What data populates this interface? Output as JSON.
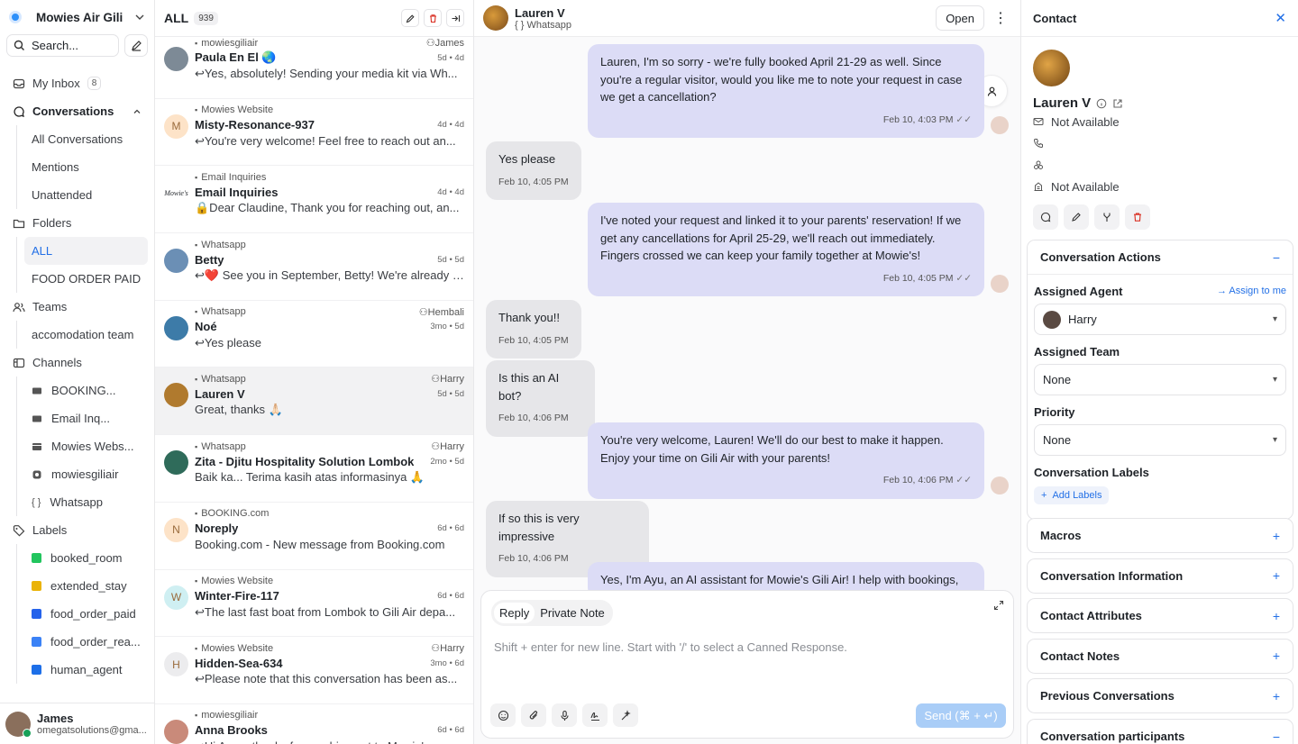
{
  "sidebar": {
    "account_name": "Mowies Air Gili",
    "search_label": "Search...",
    "my_inbox": {
      "label": "My Inbox",
      "count": "8"
    },
    "conversations_label": "Conversations",
    "conversation_items": [
      "All Conversations",
      "Mentions",
      "Unattended"
    ],
    "folders_label": "Folders",
    "folder_items": [
      "ALL",
      "FOOD ORDER PAID"
    ],
    "teams_label": "Teams",
    "team_items": [
      "accomodation team"
    ],
    "channels_label": "Channels",
    "channel_items": [
      "BOOKING...",
      "Email Inq...",
      "Mowies Webs...",
      "mowiesgiliair",
      "Whatsapp"
    ],
    "labels_label": "Labels",
    "label_items": [
      {
        "name": "booked_room",
        "color": "#22c55e"
      },
      {
        "name": "extended_stay",
        "color": "#eab308"
      },
      {
        "name": "food_order_paid",
        "color": "#2563eb"
      },
      {
        "name": "food_order_rea...",
        "color": "#3b82f6"
      },
      {
        "name": "human_agent",
        "color": "#1d6fe8"
      }
    ],
    "user": {
      "name": "James",
      "email": "omegatsolutions@gma..."
    }
  },
  "list": {
    "title": "ALL",
    "count": "939",
    "items": [
      {
        "source": "mowiesgiliair",
        "agent": "James",
        "name": "Paula En El 🌏",
        "time": "5d • 4d",
        "preview": "↩Yes, absolutely! Sending your media kit via Wh...",
        "avatar_color": "#7d8a96",
        "avatar_text": ""
      },
      {
        "source": "Mowies Website",
        "agent": "",
        "name": "Misty-Resonance-937",
        "time": "4d • 4d",
        "preview": "↩You're very welcome! Feel free to reach out an...",
        "avatar_color": "#fde3c8",
        "avatar_text": "M"
      },
      {
        "source": "Email Inquiries",
        "agent": "",
        "name": "Email Inquiries",
        "time": "4d • 4d",
        "preview": "🔒Dear Claudine, Thank you for reaching out, an...",
        "avatar_color": "#ffffff",
        "avatar_text": "Mowie's"
      },
      {
        "source": "Whatsapp",
        "agent": "",
        "name": "Betty",
        "time": "5d • 5d",
        "preview": "↩❤️ See you in September, Betty! We're already l...",
        "avatar_color": "#6b8fb5",
        "avatar_text": ""
      },
      {
        "source": "Whatsapp",
        "agent": "Hembali",
        "name": "Noé",
        "time": "3mo • 5d",
        "preview": "↩Yes please",
        "avatar_color": "#3d7ba8",
        "avatar_text": ""
      },
      {
        "source": "Whatsapp",
        "agent": "Harry",
        "name": "Lauren V",
        "time": "5d • 5d",
        "preview": "Great, thanks 🙏🏻",
        "avatar_color": "#b07a2e",
        "avatar_text": ""
      },
      {
        "source": "Whatsapp",
        "agent": "Harry",
        "name": "Zita - Djitu Hospitality Solution Lombok",
        "time": "2mo • 5d",
        "preview": "Baik ka... Terima kasih atas informasinya 🙏",
        "avatar_color": "#2f6b5a",
        "avatar_text": ""
      },
      {
        "source": "BOOKING.com",
        "agent": "",
        "name": "Noreply",
        "time": "6d • 6d",
        "preview": "Booking.com - New message from Booking.com",
        "avatar_color": "#fde3c8",
        "avatar_text": "N"
      },
      {
        "source": "Mowies Website",
        "agent": "",
        "name": "Winter-Fire-117",
        "time": "6d • 6d",
        "preview": "↩The last fast boat from Lombok to Gili Air depa...",
        "avatar_color": "#cfeff2",
        "avatar_text": "W"
      },
      {
        "source": "Mowies Website",
        "agent": "Harry",
        "name": "Hidden-Sea-634",
        "time": "3mo • 6d",
        "preview": "↩Please note that this conversation has been as...",
        "avatar_color": "#ececee",
        "avatar_text": "H"
      },
      {
        "source": "mowiesgiliair",
        "agent": "",
        "name": "Anna Brooks",
        "time": "6d • 6d",
        "preview": "↩Hi Anna, thanks for reaching out to Mowie's...",
        "avatar_color": "#c98a7a",
        "avatar_text": ""
      }
    ]
  },
  "chat": {
    "contact_name": "Lauren V",
    "channel": "Whatsapp",
    "status_button": "Open",
    "messages": [
      {
        "dir": "out",
        "text": "Lauren, I'm so sorry - we're fully booked April 21-29 as well. Since you're a regular visitor, would you like me to note your request in case we get a cancellation?",
        "time": "Feb 10, 4:03 PM"
      },
      {
        "dir": "in",
        "text": "Yes please",
        "time": "Feb 10, 4:05 PM"
      },
      {
        "dir": "out",
        "text": "I've noted your request and linked it to your parents' reservation! If we get any cancellations for April 25-29, we'll reach out immediately. Fingers crossed we can keep your family together at Mowie's!",
        "time": "Feb 10, 4:05 PM"
      },
      {
        "dir": "in",
        "text": "Thank you!!",
        "time": "Feb 10, 4:05 PM"
      },
      {
        "dir": "in",
        "text": "Is this an AI bot?",
        "time": "Feb 10, 4:06 PM"
      },
      {
        "dir": "out",
        "text": "You're very welcome, Lauren! We'll do our best to make it happen. Enjoy your time on Gili Air with your parents!",
        "time": "Feb 10, 4:06 PM"
      },
      {
        "dir": "in",
        "text": "If so this is very impressive",
        "time": "Feb 10, 4:06 PM"
      },
      {
        "dir": "out",
        "text": "Yes, I'm Ayu, an AI assistant for Mowie's Gili Air! I help with bookings,",
        "time": ""
      }
    ],
    "composer": {
      "tab_reply": "Reply",
      "tab_note": "Private Note",
      "placeholder": "Shift + enter for new line. Start with '/' to select a Canned Response.",
      "send_label": "Send (⌘ + ↵)"
    }
  },
  "contact": {
    "title": "Contact",
    "name": "Lauren V",
    "email": "Not Available",
    "company": "Not Available",
    "actions_title": "Conversation Actions",
    "assigned_agent_label": "Assigned Agent",
    "assign_to_me": "Assign to me",
    "assigned_agent": "Harry",
    "assigned_team_label": "Assigned Team",
    "assigned_team": "None",
    "priority_label": "Priority",
    "priority": "None",
    "labels_label": "Conversation Labels",
    "add_labels": "Add Labels",
    "sections": [
      "Macros",
      "Conversation Information",
      "Contact Attributes",
      "Contact Notes",
      "Previous Conversations",
      "Conversation participants"
    ]
  }
}
